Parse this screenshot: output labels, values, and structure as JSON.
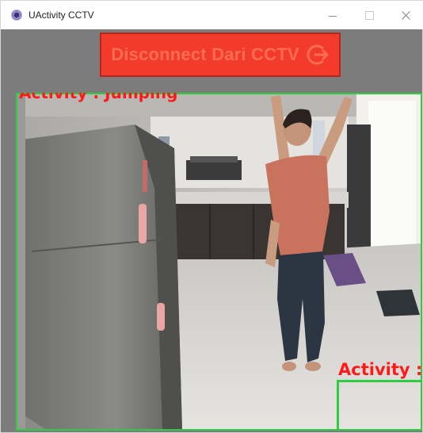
{
  "window": {
    "title": "UActivity CCTV",
    "controls": {
      "minimize": "minimize",
      "maximize": "maximize",
      "close": "close"
    }
  },
  "toolbar": {
    "disconnect_label": "Disconnect Dari CCTV",
    "disconnect_icon": "logout-icon",
    "button_color": "#f23b2a"
  },
  "video": {
    "top_label": "Activity : Jumping",
    "bottom_label": "Activity :",
    "box_color": "#2ecc40",
    "label_color": "#ff1a1a"
  }
}
